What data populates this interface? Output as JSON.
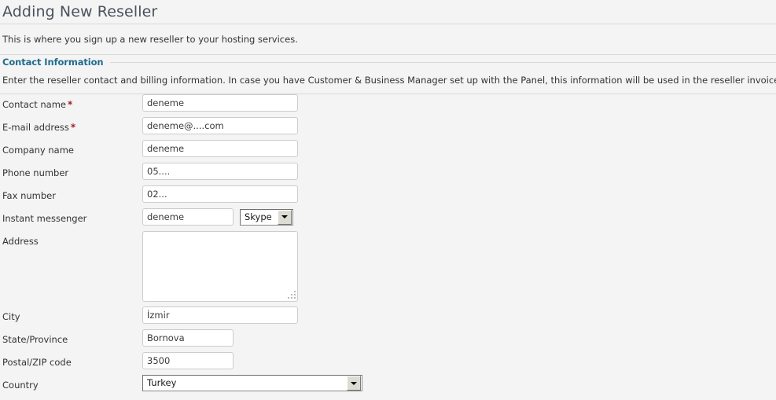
{
  "page": {
    "title": "Adding New Reseller",
    "intro": "This is where you sign up a new reseller to your hosting services."
  },
  "section": {
    "heading": "Contact Information",
    "description": "Enter the reseller contact and billing information. In case you have Customer & Business Manager set up with the Panel, this information will be used in the reseller invoices."
  },
  "required_marker": "*",
  "fields": {
    "contact_name": {
      "label": "Contact name",
      "value": "deneme"
    },
    "email_address": {
      "label": "E-mail address",
      "value": "deneme@....com"
    },
    "company_name": {
      "label": "Company name",
      "value": "deneme"
    },
    "phone_number": {
      "label": "Phone number",
      "value": "05...."
    },
    "fax_number": {
      "label": "Fax number",
      "value": "02..."
    },
    "instant_messenger": {
      "label": "Instant messenger",
      "value": "deneme",
      "type_selected": "Skype"
    },
    "address": {
      "label": "Address",
      "value": ""
    },
    "city": {
      "label": "City",
      "value": "İzmir"
    },
    "state_province": {
      "label": "State/Province",
      "value": "Bornova"
    },
    "postal_zip_code": {
      "label": "Postal/ZIP code",
      "value": "3500"
    },
    "country": {
      "label": "Country",
      "selected": "Turkey"
    }
  },
  "colors": {
    "page_background": "#f4f4f4",
    "title_text": "#4a525e",
    "section_heading": "#1f6b8e",
    "required_asterisk": "#a32020",
    "divider": "#d9d9d9",
    "input_border": "#cccccc"
  }
}
